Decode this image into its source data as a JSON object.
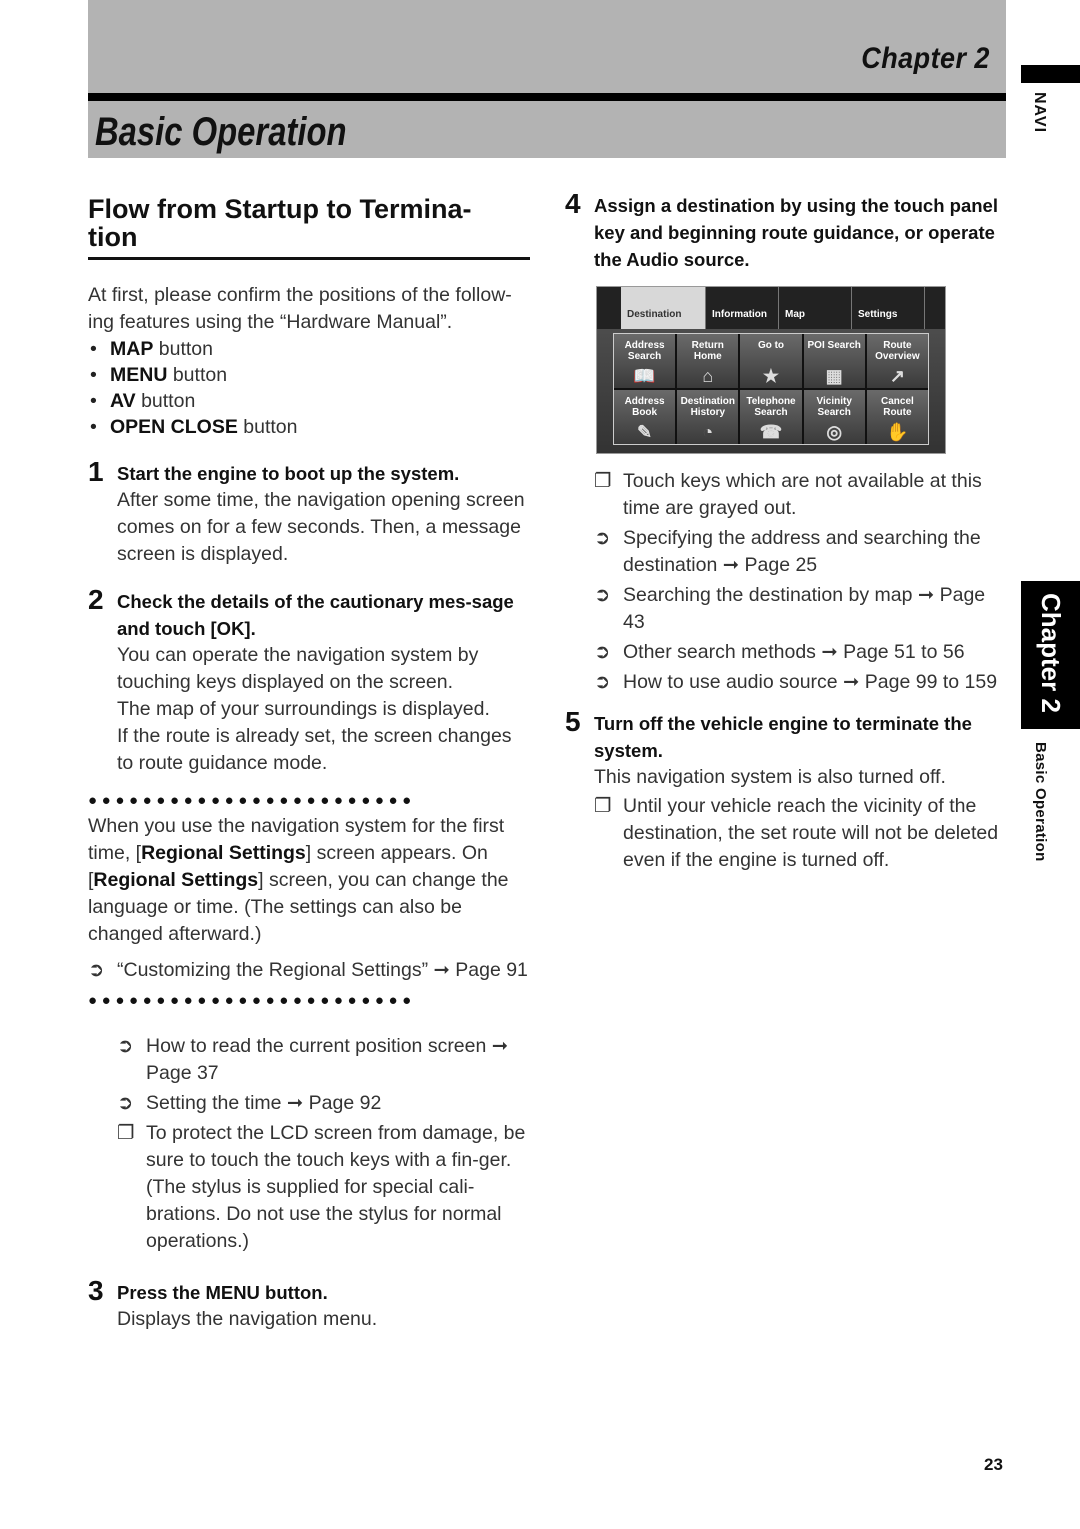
{
  "header": {
    "chapter": "Chapter 2",
    "title": "Basic Operation"
  },
  "side": {
    "navi": "NAVI",
    "chapter_tab": "Chapter 2",
    "section": "Basic Operation"
  },
  "left": {
    "section_title": "Flow from Startup to Termina-tion",
    "section_title_line1": "Flow from Startup to Termina-",
    "section_title_line2": "tion",
    "intro": "At first, please confirm the positions of the follow-ing features using the “Hardware Manual”.",
    "bullets": [
      {
        "bold": "MAP",
        "rest": " button"
      },
      {
        "bold": "MENU",
        "rest": " button"
      },
      {
        "bold": "AV",
        "rest": " button"
      },
      {
        "bold": "OPEN CLOSE",
        "rest": " button"
      }
    ],
    "step1": {
      "num": "1",
      "head": "Start the engine to boot up the system.",
      "body": "After some time, the navigation opening screen comes on for a few seconds. Then, a message screen is displayed."
    },
    "step2": {
      "num": "2",
      "head": "Check the details of the cautionary mes-sage and touch [OK].",
      "body1": "You can operate the navigation system by touching keys displayed on the screen.",
      "body2": "The map of your surroundings is displayed.",
      "body3": "If the route is already set, the screen changes to route guidance mode."
    },
    "note_box": {
      "dots": "●●●●●●●●●●●●●●●●●●●●●●●●",
      "text_a": "When you use the navigation system for the first time, [",
      "bold_a": "Regional Settings",
      "text_b": "] screen appears. On [",
      "bold_b": "Regional Settings",
      "text_c": "] screen, you can change the language or time. (The settings can also be changed afterward.)",
      "ref_symbol": "➲",
      "ref": "“Customizing the Regional Settings” ➞ Page 91"
    },
    "refs": [
      {
        "symbol": "➲",
        "text": "How to read the current position screen ➞ Page 37"
      },
      {
        "symbol": "➲",
        "text": "Setting the time ➞ Page 92"
      },
      {
        "symbol": "❐",
        "text": "To protect the LCD screen from damage, be sure to touch the touch keys with a fin-ger. (The stylus is supplied for special cali-brations. Do not use the stylus for normal operations.)"
      }
    ],
    "step3": {
      "num": "3",
      "head_a": "Press the ",
      "head_bold": "MENU",
      "head_b": " button.",
      "body": "Displays the navigation menu."
    }
  },
  "right": {
    "step4": {
      "num": "4",
      "head": "Assign a destination by using the touch panel key and beginning route guidance, or operate the Audio source."
    },
    "screen": {
      "tabs": [
        "Destination",
        "Information",
        "Map",
        "Settings"
      ],
      "keys": [
        {
          "label": "Address Search",
          "icon": "📖"
        },
        {
          "label": "Return Home",
          "icon": "⌂"
        },
        {
          "label": "Go to",
          "icon": "★"
        },
        {
          "label": "POI Search",
          "icon": "▦"
        },
        {
          "label": "Route Overview",
          "icon": "↗"
        },
        {
          "label": "Address Book",
          "icon": "✎"
        },
        {
          "label": "Destination History",
          "icon": "◔"
        },
        {
          "label": "Telephone Search",
          "icon": "☎"
        },
        {
          "label": "Vicinity Search",
          "icon": "◎"
        },
        {
          "label": "Cancel Route",
          "icon": "✋"
        }
      ]
    },
    "refs": [
      {
        "symbol": "❐",
        "text": "Touch keys which are not available at this time are grayed out."
      },
      {
        "symbol": "➲",
        "text": "Specifying the address and searching the destination ➞ Page 25"
      },
      {
        "symbol": "➲",
        "text": "Searching the destination by map ➞ Page 43"
      },
      {
        "symbol": "➲",
        "text": "Other search methods ➞ Page 51 to 56"
      },
      {
        "symbol": "➲",
        "text": "How to use audio source ➞ Page 99 to 159"
      }
    ],
    "step5": {
      "num": "5",
      "head": "Turn off the vehicle engine to terminate the system.",
      "body": "This navigation system is also turned off.",
      "note_symbol": "❐",
      "note": "Until your vehicle reach the vicinity of the destination, the set route will not be deleted even if the engine is turned off."
    }
  },
  "footer": {
    "page_number": "23"
  }
}
